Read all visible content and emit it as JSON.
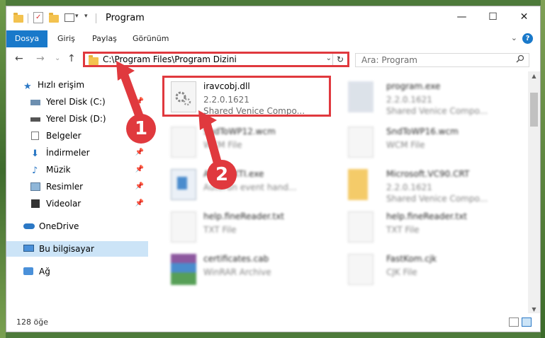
{
  "window": {
    "title": "Program",
    "controls": {
      "minimize": "—",
      "maximize": "☐",
      "close": "✕"
    }
  },
  "ribbon": {
    "tabs": [
      "Dosya",
      "Giriş",
      "Paylaş",
      "Görünüm"
    ],
    "expand_icon": "chevron-down-icon",
    "help": "?"
  },
  "nav": {
    "back": "←",
    "forward": "→",
    "recent": "⌄",
    "up": "↑"
  },
  "address": {
    "path": "C:\\Program Files\\Program Dizini",
    "dropdown": "⌄",
    "refresh": "↻"
  },
  "search": {
    "placeholder": "Ara: Program",
    "icon": "search-icon"
  },
  "sidebar": {
    "items": [
      {
        "label": "Hızlı erişim",
        "icon": "star-icon",
        "pinned": false
      },
      {
        "label": "Yerel Disk (C:)",
        "icon": "drive-icon",
        "pinned": true
      },
      {
        "label": "Yerel Disk (D:)",
        "icon": "drive-icon",
        "pinned": true
      },
      {
        "label": "Belgeler",
        "icon": "documents-icon",
        "pinned": true
      },
      {
        "label": "İndirmeler",
        "icon": "download-icon",
        "pinned": true
      },
      {
        "label": "Müzik",
        "icon": "music-icon",
        "pinned": true
      },
      {
        "label": "Resimler",
        "icon": "pictures-icon",
        "pinned": true
      },
      {
        "label": "Videolar",
        "icon": "video-icon",
        "pinned": true
      },
      {
        "label": "OneDrive",
        "icon": "cloud-icon",
        "pinned": false
      },
      {
        "label": "Bu bilgisayar",
        "icon": "computer-icon",
        "pinned": false
      },
      {
        "label": "Ağ",
        "icon": "network-icon",
        "pinned": false
      }
    ],
    "pin_icon": "📌"
  },
  "files": [
    {
      "name": "iravcobj.dll",
      "version": "2.2.0.1621",
      "description": "Shared Venice Compo...",
      "icon": "dll-gear-icon",
      "highlighted": true
    },
    {
      "name": "program.exe",
      "version": "2.2.0.1621",
      "description": "Shared Venice Compo...",
      "icon": "exe-icon",
      "highlighted": false
    },
    {
      "name": "SndToWP12.wcm",
      "version": "WCM File",
      "description": "",
      "icon": "file-icon",
      "highlighted": false
    },
    {
      "name": "SndToWP16.wcm",
      "version": "WCM File",
      "description": "",
      "icon": "file-icon",
      "highlighted": false
    },
    {
      "name": "AUTOEXTI.exe",
      "version": "Autorun event hand...",
      "description": "",
      "icon": "exe-window-icon",
      "highlighted": false
    },
    {
      "name": "Microsoft.VC90.CRT",
      "version": "2.2.0.1621",
      "description": "Shared Venice Compo...",
      "icon": "folder-icon",
      "highlighted": false
    },
    {
      "name": "help.fineReader.txt",
      "version": "TXT File",
      "description": "",
      "icon": "file-icon",
      "highlighted": false
    },
    {
      "name": "help.fineReader.txt",
      "version": "TXT File",
      "description": "",
      "icon": "file-icon",
      "highlighted": false
    },
    {
      "name": "certificates.cab",
      "version": "WinRAR Archive",
      "description": "",
      "icon": "archive-icon",
      "highlighted": false
    },
    {
      "name": "FastKom.cjk",
      "version": "CJK File",
      "description": "",
      "icon": "file-icon",
      "highlighted": false
    }
  ],
  "status": {
    "count": "128 öğe"
  },
  "annotations": {
    "badge1": "1",
    "badge2": "2"
  },
  "colors": {
    "accent": "#1979ca",
    "highlight_red": "#e0393e",
    "selected_bg": "#cce4f7"
  }
}
